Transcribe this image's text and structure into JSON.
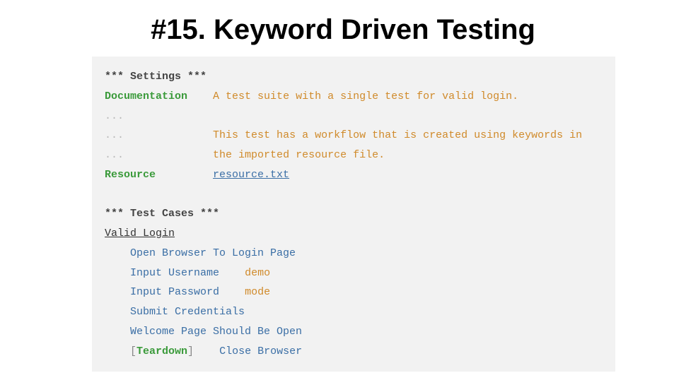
{
  "title": "#15. Keyword Driven Testing",
  "code": {
    "settingsHeader": "*** Settings ***",
    "docKeyword": "Documentation",
    "docLine1": "A test suite with a single test for valid login.",
    "ellipsis": "...",
    "docLine2": "This test has a workflow that is created using keywords in",
    "docLine3": "the imported resource file.",
    "resourceKeyword": "Resource",
    "resourceValue": "resource.txt",
    "testCasesHeader": "*** Test Cases ***",
    "testName": "Valid Login",
    "step1": "Open Browser To Login Page",
    "step2Keyword": "Input Username",
    "step2Arg": "demo",
    "step3Keyword": "Input Password",
    "step3Arg": "mode",
    "step4": "Submit Credentials",
    "step5": "Welcome Page Should Be Open",
    "teardownOpen": "[",
    "teardownKeyword": "Teardown",
    "teardownClose": "]",
    "teardownAction": "Close Browser"
  }
}
